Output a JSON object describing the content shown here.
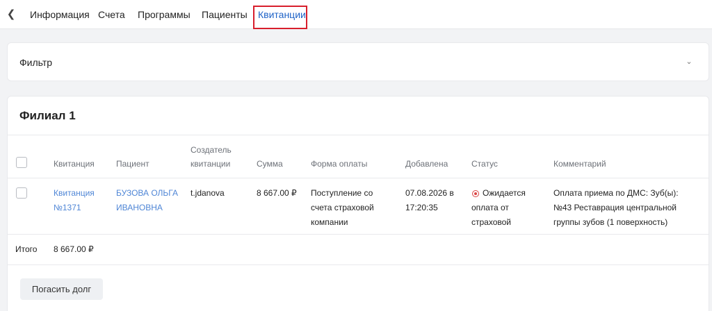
{
  "nav": {
    "tabs": [
      {
        "label": "Информация"
      },
      {
        "label": "Счета"
      },
      {
        "label": "Программы"
      },
      {
        "label": "Пациенты"
      },
      {
        "label": "Квитанции",
        "active": true
      }
    ]
  },
  "filter": {
    "title": "Фильтр"
  },
  "branch": {
    "title": "Филиал 1"
  },
  "table": {
    "headers": {
      "receipt": "Квитанция",
      "patient": "Пациент",
      "creator_line1": "Создатель",
      "creator_line2": "квитанции",
      "sum": "Сумма",
      "payment_form": "Форма оплаты",
      "added": "Добавлена",
      "status": "Статус",
      "comment": "Комментарий"
    },
    "rows": [
      {
        "receipt_line1": "Квитанция",
        "receipt_line2": "№1371",
        "patient_line1": "БУЗОВА ОЛЬГА",
        "patient_line2": "ИВАНОВНА",
        "creator": "t.jdanova",
        "sum": "8 667.00 ₽",
        "payment_line1": "Поступление со",
        "payment_line2": "счета страховой",
        "payment_line3": "компании",
        "added_line1": "07.08.2026 в",
        "added_line2": "17:20:35",
        "status_line1": "Ожидается",
        "status_line2": "оплата от",
        "status_line3": "страховой",
        "comment_line1": "Оплата приема по ДМС: Зуб(ы):",
        "comment_line2": "№43 Реставрация центральной",
        "comment_line3": "группы зубов (1 поверхность)"
      }
    ]
  },
  "totals": {
    "label": "Итого",
    "value": "8 667.00 ₽"
  },
  "actions": {
    "pay_debt": "Погасить долг"
  },
  "colors": {
    "accent": "#1f63c7",
    "link": "#4f86d6",
    "highlight": "#d81e2c",
    "status": "#d94545"
  }
}
